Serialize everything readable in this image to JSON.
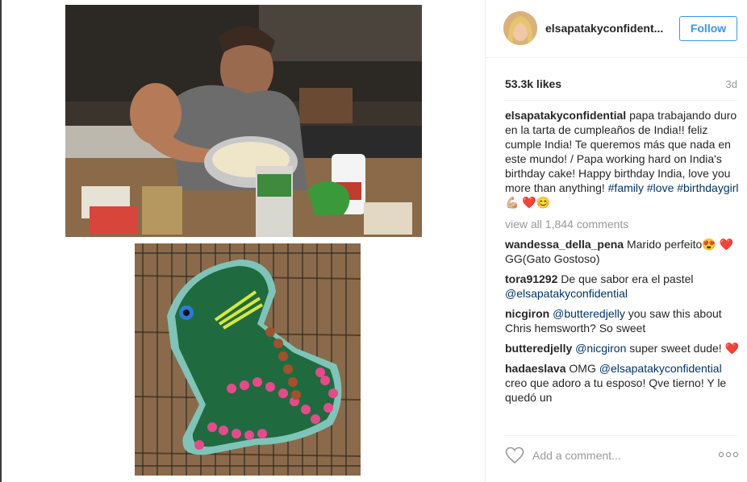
{
  "post": {
    "username": "elsapatakyconfident...",
    "follow_label": "Follow",
    "likes": "53.3k likes",
    "timestamp": "3d"
  },
  "caption": {
    "user": "elsapatakyconfidential",
    "text": "papa trabajando duro en la tarta de cumpleaños de India!! feliz cumple India! Te queremos más que nada en este mundo! / Papa working hard on India's birthday cake! Happy birthday India, love you more than anything! ",
    "hashtags": [
      "#family",
      "#love",
      "#birthdaygirl"
    ],
    "emoji_tail": "💪🏼 ❤️😊"
  },
  "view_all": "view all 1,844 comments",
  "comments": [
    {
      "user": "wandessa_della_pena",
      "pre": "Marido perfeito😍 ❤️ GG(Gato Gostoso)",
      "mention": "",
      "post": ""
    },
    {
      "user": "tora91292",
      "pre": "De que sabor era el pastel ",
      "mention": "@elsapatakyconfidential",
      "post": ""
    },
    {
      "user": "nicgiron",
      "pre": "",
      "mention": "@butteredjelly",
      "post": " you saw this about Chris hemsworth? So sweet"
    },
    {
      "user": "butteredjelly",
      "pre": "",
      "mention": "@nicgiron",
      "post": " super sweet dude! ❤️"
    },
    {
      "user": "hadaeslava",
      "pre": "OMG ",
      "mention": "@elsapatakyconfidential",
      "post": " creo que adoro a tu esposo! Qve tierno! Y le quedó un"
    }
  ],
  "add_comment": {
    "placeholder": "Add a comment..."
  },
  "icons": {
    "heart": "heart-icon",
    "more": "more-options-icon"
  },
  "colors": {
    "link": "#003569",
    "follow": "#3897f0",
    "muted": "#999999"
  }
}
